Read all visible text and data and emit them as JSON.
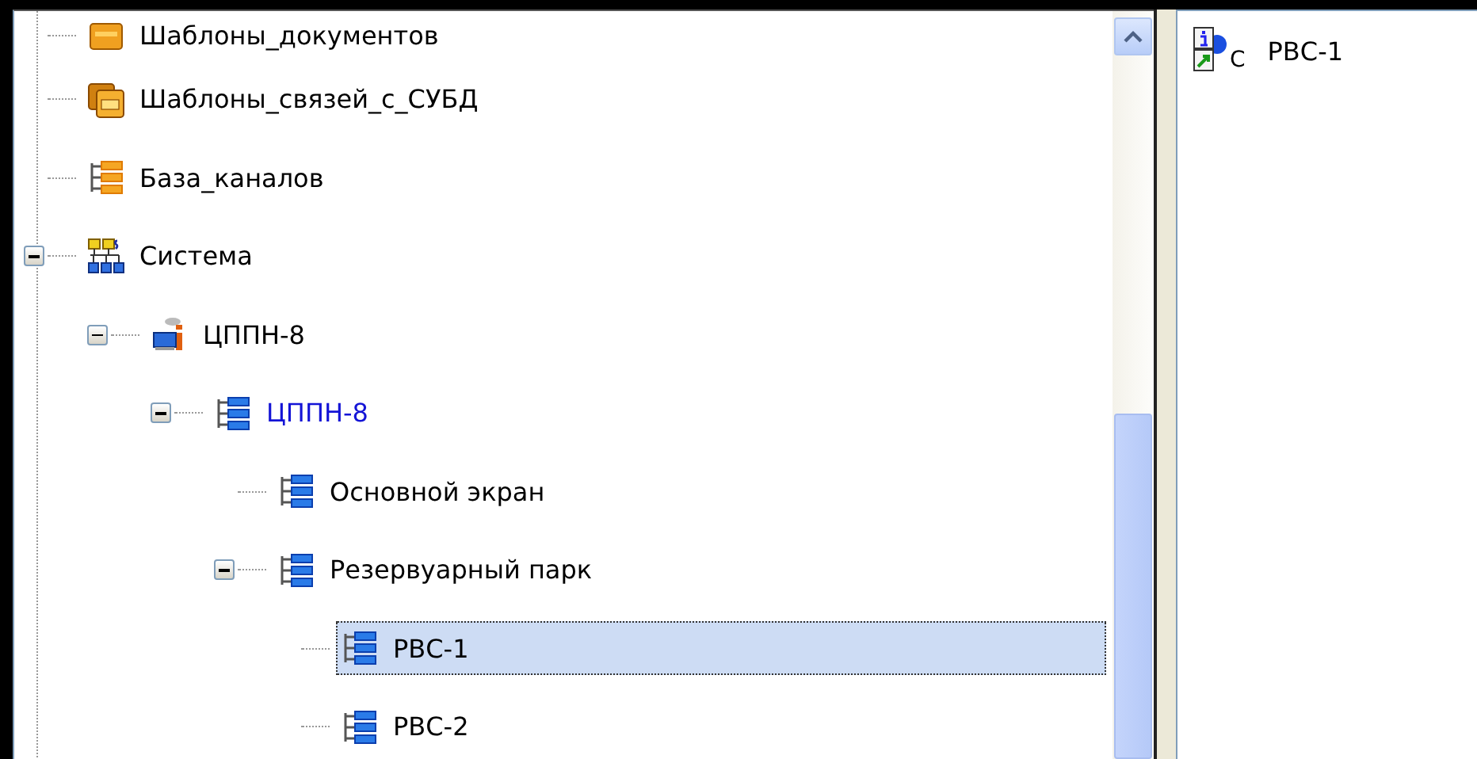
{
  "tree": [
    {
      "label": "Шаблоны_документов",
      "kind": "doc-templates",
      "selected": false,
      "highlighted": false
    },
    {
      "label": "Шаблоны_связей_с_СУБД",
      "kind": "db-templates",
      "selected": false,
      "highlighted": false
    },
    {
      "label": "База_каналов",
      "kind": "channels",
      "selected": false,
      "highlighted": false
    },
    {
      "label": "Система",
      "kind": "system",
      "selected": false,
      "highlighted": false,
      "expanded": true,
      "children": [
        {
          "label": "ЦППН-8",
          "kind": "factory",
          "selected": false,
          "highlighted": false,
          "expanded": true,
          "children": [
            {
              "label": "ЦППН-8",
              "kind": "screen",
              "selected": false,
              "highlighted": true,
              "expanded": true,
              "children": [
                {
                  "label": "Основной экран",
                  "kind": "screen",
                  "selected": false,
                  "highlighted": false
                },
                {
                  "label": "Резервуарный парк",
                  "kind": "screen",
                  "selected": false,
                  "highlighted": false,
                  "expanded": true,
                  "children": [
                    {
                      "label": "РВС-1",
                      "kind": "screen",
                      "selected": true,
                      "highlighted": false
                    },
                    {
                      "label": "РВС-2",
                      "kind": "screen",
                      "selected": false,
                      "highlighted": false
                    }
                  ]
                }
              ]
            }
          ]
        }
      ]
    }
  ],
  "details": {
    "items": [
      {
        "label": "РВС-1",
        "icon_label": "C"
      }
    ]
  }
}
